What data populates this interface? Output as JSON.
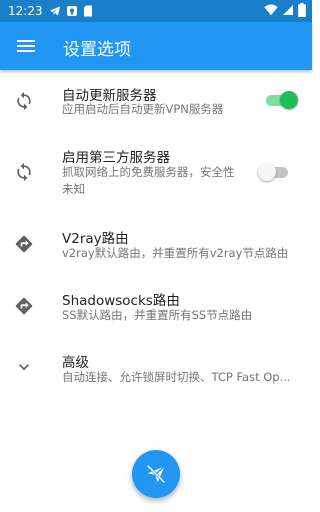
{
  "status_bar": {
    "time": "12:23",
    "left_icons": [
      "telegram-icon",
      "app-notification-icon",
      "sd-card-icon"
    ],
    "right_icons": [
      "wifi-icon",
      "signal-icon",
      "battery-icon"
    ]
  },
  "app_bar": {
    "title": "设置选项",
    "menu_icon": "menu-icon",
    "color": "#2196f3"
  },
  "settings": [
    {
      "icon": "sync-icon",
      "title": "自动更新服务器",
      "summary": "应用启动后自动更新VPN服务器",
      "toggle": true
    },
    {
      "icon": "sync-icon",
      "title": "启用第三方服务器",
      "summary": "抓取网络上的免费服务器，安全性未知",
      "toggle": false
    },
    {
      "icon": "route-icon",
      "title": "V2ray路由",
      "summary": "v2ray默认路由，并重置所有v2ray节点路由"
    },
    {
      "icon": "route-icon",
      "title": "Shadowsocks路由",
      "summary": "SS默认路由，并重置所有SS节点路由"
    },
    {
      "icon": "chevron-down-icon",
      "title": "高级",
      "summary": "自动连接、允许锁屏时切换、TCP Fast Op..."
    }
  ],
  "fab": {
    "icon": "paper-plane-off-icon"
  },
  "colors": {
    "accent": "#2196f3",
    "status_bar": "#1a7fc8",
    "switch_on": "#1fbf5a"
  }
}
